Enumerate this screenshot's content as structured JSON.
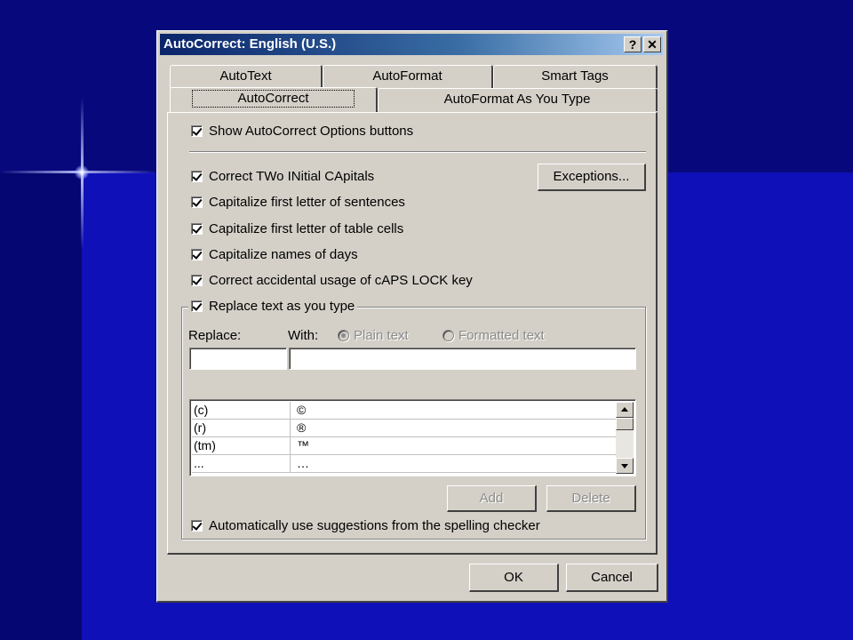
{
  "window": {
    "title": "AutoCorrect: English (U.S.)",
    "help_btn": "?",
    "close_btn": "✕"
  },
  "tabs": {
    "row1": [
      "AutoText",
      "AutoFormat",
      "Smart Tags"
    ],
    "row2": [
      "AutoCorrect",
      "AutoFormat As You Type"
    ],
    "active": "AutoCorrect"
  },
  "options": {
    "show_buttons": "Show AutoCorrect Options buttons",
    "two_initial_caps": "Correct TWo INitial CApitals",
    "cap_sentences": "Capitalize first letter of sentences",
    "cap_table_cells": "Capitalize first letter of table cells",
    "cap_days": "Capitalize names of days",
    "caps_lock": "Correct accidental usage of cAPS LOCK key",
    "replace_as_type": "Replace text as you type",
    "use_suggestions": "Automatically use suggestions from the spelling checker"
  },
  "buttons": {
    "exceptions": "Exceptions...",
    "add": "Add",
    "delete": "Delete",
    "ok": "OK",
    "cancel": "Cancel"
  },
  "replace_section": {
    "replace_label": "Replace:",
    "with_label": "With:",
    "plain_text": "Plain text",
    "formatted_text": "Formatted text",
    "replace_value": "",
    "with_value": ""
  },
  "entries": [
    {
      "replace": "(c)",
      "with": "©"
    },
    {
      "replace": "(r)",
      "with": "®"
    },
    {
      "replace": "(tm)",
      "with": "™"
    },
    {
      "replace": "...",
      "with": "…"
    }
  ]
}
